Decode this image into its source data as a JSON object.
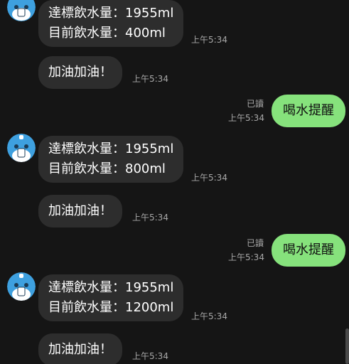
{
  "colors": {
    "background": "#151515",
    "incoming_bubble": "#2d2d2d",
    "outgoing_bubble": "#86e27c",
    "avatar_blue": "#3ea0df"
  },
  "icons": {
    "avatar": "bot-avatar-icon"
  },
  "messages": {
    "m1": {
      "line1": "達標飲水量：1955ml",
      "line2": "目前飲水量：400ml",
      "time": "上午5:34"
    },
    "m2": {
      "text": "加油加油！",
      "time": "上午5:34"
    },
    "m3": {
      "text": "喝水提醒",
      "read": "已讀",
      "time": "上午5:34"
    },
    "m4": {
      "line1": "達標飲水量：1955ml",
      "line2": "目前飲水量：800ml",
      "time": "上午5:34"
    },
    "m5": {
      "text": "加油加油！",
      "time": "上午5:34"
    },
    "m6": {
      "text": "喝水提醒",
      "read": "已讀",
      "time": "上午5:34"
    },
    "m7": {
      "line1": "達標飲水量：1955ml",
      "line2": "目前飲水量：1200ml",
      "time": "上午5:34"
    },
    "m8": {
      "text": "加油加油！",
      "time": "上午5:34"
    }
  }
}
